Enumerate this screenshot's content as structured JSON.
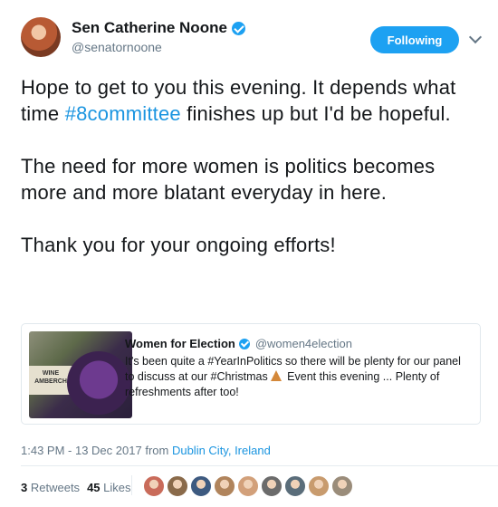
{
  "author": {
    "name": "Sen Catherine Noone",
    "handle": "@senatornoone"
  },
  "follow_button": {
    "label": "Following"
  },
  "tweet": {
    "paragraphs": [
      {
        "before": "Hope to get to you this evening. It depends what time ",
        "hashtag": "#8committee",
        "after": " finishes up but I'd be hopeful."
      },
      {
        "text": "The need for more women is politics becomes more and more blatant everyday in here."
      },
      {
        "text": "Thank you for your ongoing efforts!"
      }
    ]
  },
  "quoted_tweet": {
    "name": "Women for Election",
    "handle": "@women4election",
    "text_before": "It's been quite a #YearInPolitics so there will be plenty for our panel to discuss at our #Christmas",
    "text_after": " Event this evening ... Plenty of refreshments after too!",
    "image_sign": "WINE AMBERCH"
  },
  "meta": {
    "time": "1:43 PM - 13 Dec 2017",
    "from_label": "from",
    "location": "Dublin City, Ireland"
  },
  "stats": {
    "retweets_count": "3",
    "retweets_label": "Retweets",
    "likes_count": "45",
    "likes_label": "Likes"
  },
  "likers": [
    {
      "icon": "liker-avatar",
      "color": "#c96b5a"
    },
    {
      "icon": "liker-avatar",
      "color": "#8a6a4a"
    },
    {
      "icon": "liker-avatar",
      "color": "#3d5a80"
    },
    {
      "icon": "liker-avatar",
      "color": "#b0845c"
    },
    {
      "icon": "liker-avatar",
      "color": "#d2a07a"
    },
    {
      "icon": "liker-avatar",
      "color": "#6b6b6b"
    },
    {
      "icon": "liker-avatar",
      "color": "#5a6d7a"
    },
    {
      "icon": "liker-avatar",
      "color": "#c89b6e"
    },
    {
      "icon": "liker-avatar",
      "color": "#9a8c7a"
    }
  ],
  "colors": {
    "accent": "#1da1f2",
    "link": "#1b95e0",
    "muted": "#657786"
  }
}
